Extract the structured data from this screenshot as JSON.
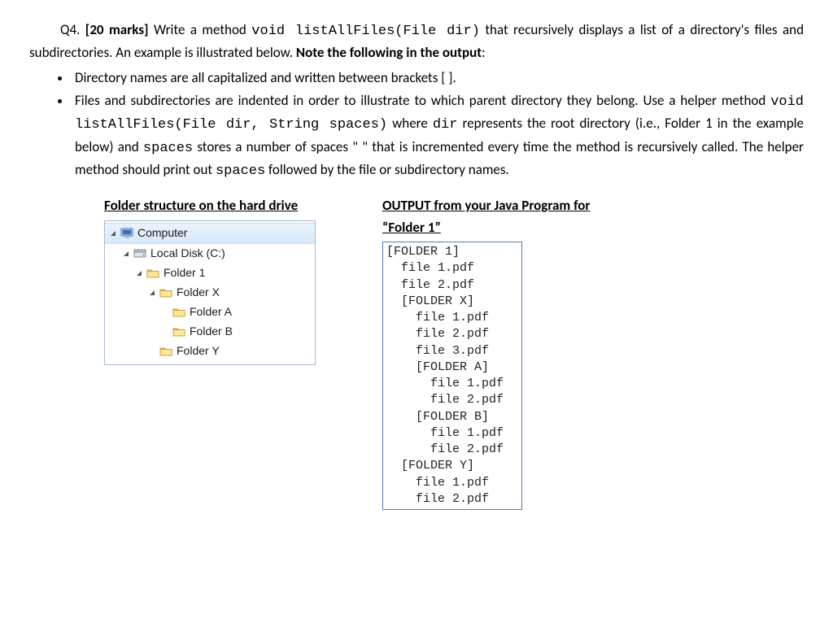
{
  "question": {
    "number": "Q4.",
    "marks": "[20 marks]",
    "text1": " Write a method ",
    "code1": "void listAllFiles(File dir)",
    "text2": " that recursively displays a list of a directory's files and subdirectories. An example is illustrated below. ",
    "bold_tail": "Note the following in the output",
    "colon": ":"
  },
  "bullets": [
    {
      "text": "Directory names are all capitalized and written between brackets [ ]."
    },
    {
      "pre": "Files and subdirectories are indented in order to illustrate to which parent directory they belong. Use a helper method ",
      "code1": "void listAllFiles(File dir, String spaces)",
      "mid1": " where ",
      "code2": "dir",
      "mid2": " represents the root directory (i.e., Folder 1 in the example below) and ",
      "code3": "spaces",
      "mid3": " stores a number of spaces \"   \" that is incremented every time the method is recursively called. The helper method should print out ",
      "code4": "spaces",
      "mid4": " followed by the file or subdirectory names."
    }
  ],
  "left": {
    "title": "Folder structure on the hard drive",
    "tree": [
      {
        "depth": 0,
        "arrow": "open",
        "icon": "computer",
        "label": "Computer",
        "selected": true
      },
      {
        "depth": 1,
        "arrow": "open",
        "icon": "drive",
        "label": "Local Disk (C:)"
      },
      {
        "depth": 2,
        "arrow": "open",
        "icon": "folder",
        "label": "Folder 1"
      },
      {
        "depth": 3,
        "arrow": "open",
        "icon": "folder",
        "label": "Folder X"
      },
      {
        "depth": 4,
        "arrow": "none",
        "icon": "folder",
        "label": "Folder A"
      },
      {
        "depth": 4,
        "arrow": "none",
        "icon": "folder",
        "label": "Folder B"
      },
      {
        "depth": 3,
        "arrow": "none",
        "icon": "folder",
        "label": "Folder Y"
      }
    ]
  },
  "right": {
    "title1": "OUTPUT from your Java Program for ",
    "title2": "“Folder 1”",
    "lines": [
      "[FOLDER 1]",
      "  file 1.pdf",
      "  file 2.pdf",
      "  [FOLDER X]",
      "    file 1.pdf",
      "    file 2.pdf",
      "    file 3.pdf",
      "    [FOLDER A]",
      "      file 1.pdf",
      "      file 2.pdf",
      "    [FOLDER B]",
      "      file 1.pdf",
      "      file 2.pdf",
      "  [FOLDER Y]",
      "    file 1.pdf",
      "    file 2.pdf"
    ]
  }
}
